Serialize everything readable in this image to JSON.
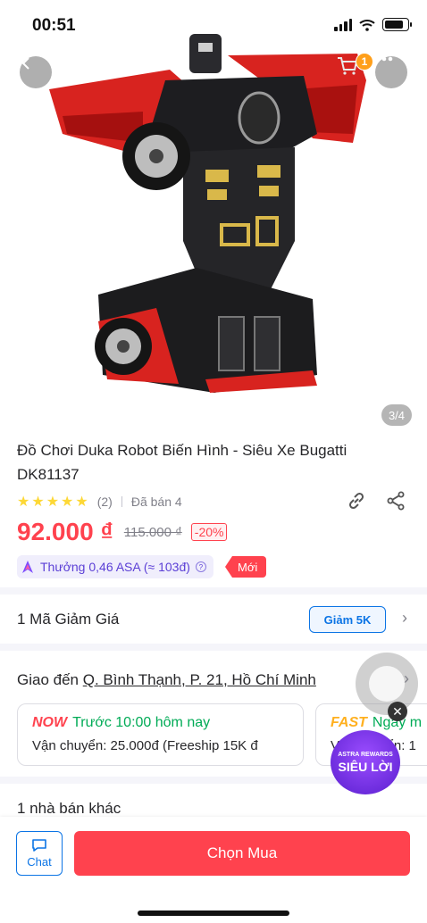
{
  "status_bar": {
    "time": "00:51"
  },
  "header": {
    "cart_count": "1",
    "image_counter": "3/4"
  },
  "product": {
    "title": "Đồ Chơi Duka Robot Biến Hình - Siêu Xe Bugatti DK81137",
    "stars": "★★★★★",
    "rating_count": "(2)",
    "sold": "Đã bán 4",
    "price": "92.000 ₫",
    "old_price": "115.000 ₫",
    "discount": "-20%",
    "reward": "Thưởng 0,46 ASA (≈ 103đ)",
    "new_tag": "Mới"
  },
  "coupon": {
    "label": "1 Mã Giảm Giá",
    "chip": "Giảm 5K"
  },
  "shipping": {
    "prefix": "Giao đến ",
    "address": "Q. Bình Thạnh, P. 21, Hồ Chí Minh",
    "card1": {
      "badge": "NOW",
      "eta": "Trước 10:00 hôm nay",
      "fee": "Vận chuyển: 25.000đ (Freeship 15K đ"
    },
    "card2": {
      "badge": "FAST",
      "eta": "Ngày m",
      "fee": "Vận chuyển: 1"
    }
  },
  "sellers": {
    "label": "1 nhà bán khác"
  },
  "promo": {
    "small": "ASTRA REWARDS",
    "big": "SIÊU LỜI"
  },
  "bottom": {
    "chat_label": "Chat",
    "buy_label": "Chọn Mua"
  },
  "colors": {
    "accent": "#ff424e",
    "link": "#0b74e5",
    "now": "#ff424e",
    "fast": "#ffb01f",
    "green": "#00ab56"
  }
}
